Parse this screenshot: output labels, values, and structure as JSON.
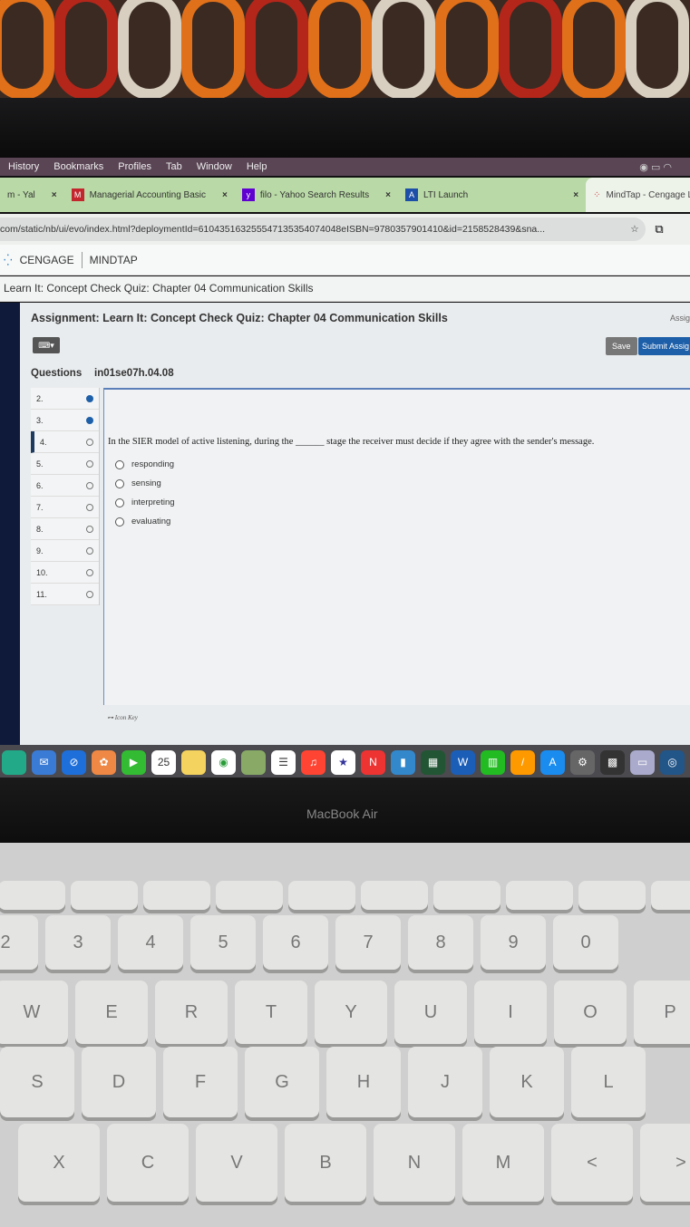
{
  "menubar": {
    "items": [
      "History",
      "Bookmarks",
      "Profiles",
      "Tab",
      "Window",
      "Help"
    ]
  },
  "tabs": [
    {
      "label": "m - Yal",
      "icon": "yahoo-mail-icon"
    },
    {
      "label": "Managerial Accounting Basic",
      "icon": "mcgraw-hill-icon"
    },
    {
      "label": "filo - Yahoo Search Results",
      "icon": "yahoo-icon"
    },
    {
      "label": "LTI Launch",
      "icon": "lti-icon"
    },
    {
      "label": "MindTap - Cengage Lea",
      "icon": "cengage-icon",
      "active": true
    }
  ],
  "url": "com/static/nb/ui/evo/index.html?deploymentId=610435163255547135354074048eISBN=9780357901410&id=2158528439&sna...",
  "app": {
    "brand": "CENGAGE",
    "product": "MINDTAP"
  },
  "breadcrumb": "Learn It: Concept Check Quiz: Chapter 04 Communication Skills",
  "assignment": {
    "title": "Assignment: Learn It: Concept Check Quiz: Chapter 04 Communication Skills",
    "right_label": "Assig",
    "save": "Save",
    "submit": "Submit Assig",
    "questions_label": "Questions",
    "question_id": "in01se07h.04.08",
    "questions": [
      {
        "n": "2.",
        "state": "answered"
      },
      {
        "n": "3.",
        "state": "answered"
      },
      {
        "n": "4.",
        "state": "current"
      },
      {
        "n": "5.",
        "state": "open"
      },
      {
        "n": "6.",
        "state": "open"
      },
      {
        "n": "7.",
        "state": "open"
      },
      {
        "n": "8.",
        "state": "open"
      },
      {
        "n": "9.",
        "state": "open"
      },
      {
        "n": "10.",
        "state": "open"
      },
      {
        "n": "11.",
        "state": "open"
      }
    ],
    "question_text": "In the SIER model of active listening, during the ______ stage the receiver must decide if they agree with the sender's message.",
    "options": [
      "responding",
      "sensing",
      "interpreting",
      "evaluating"
    ],
    "icon_key": "Icon Key"
  },
  "dock": {
    "calendar_day": "25"
  },
  "laptop": {
    "brand": "MacBook Air"
  },
  "keyboard": {
    "rows": [
      [
        "2",
        "3",
        "4",
        "5",
        "6",
        "7",
        "8",
        "9",
        "0"
      ],
      [
        "W",
        "E",
        "R",
        "T",
        "Y",
        "U",
        "I",
        "O",
        "P"
      ],
      [
        "S",
        "D",
        "F",
        "G",
        "H",
        "J",
        "K",
        "L"
      ],
      [
        "X",
        "C",
        "V",
        "B",
        "N",
        "M",
        "<",
        ">"
      ]
    ]
  },
  "colors": {
    "accent": "#1d5fa8",
    "tabbar": "#b9d9a6"
  }
}
